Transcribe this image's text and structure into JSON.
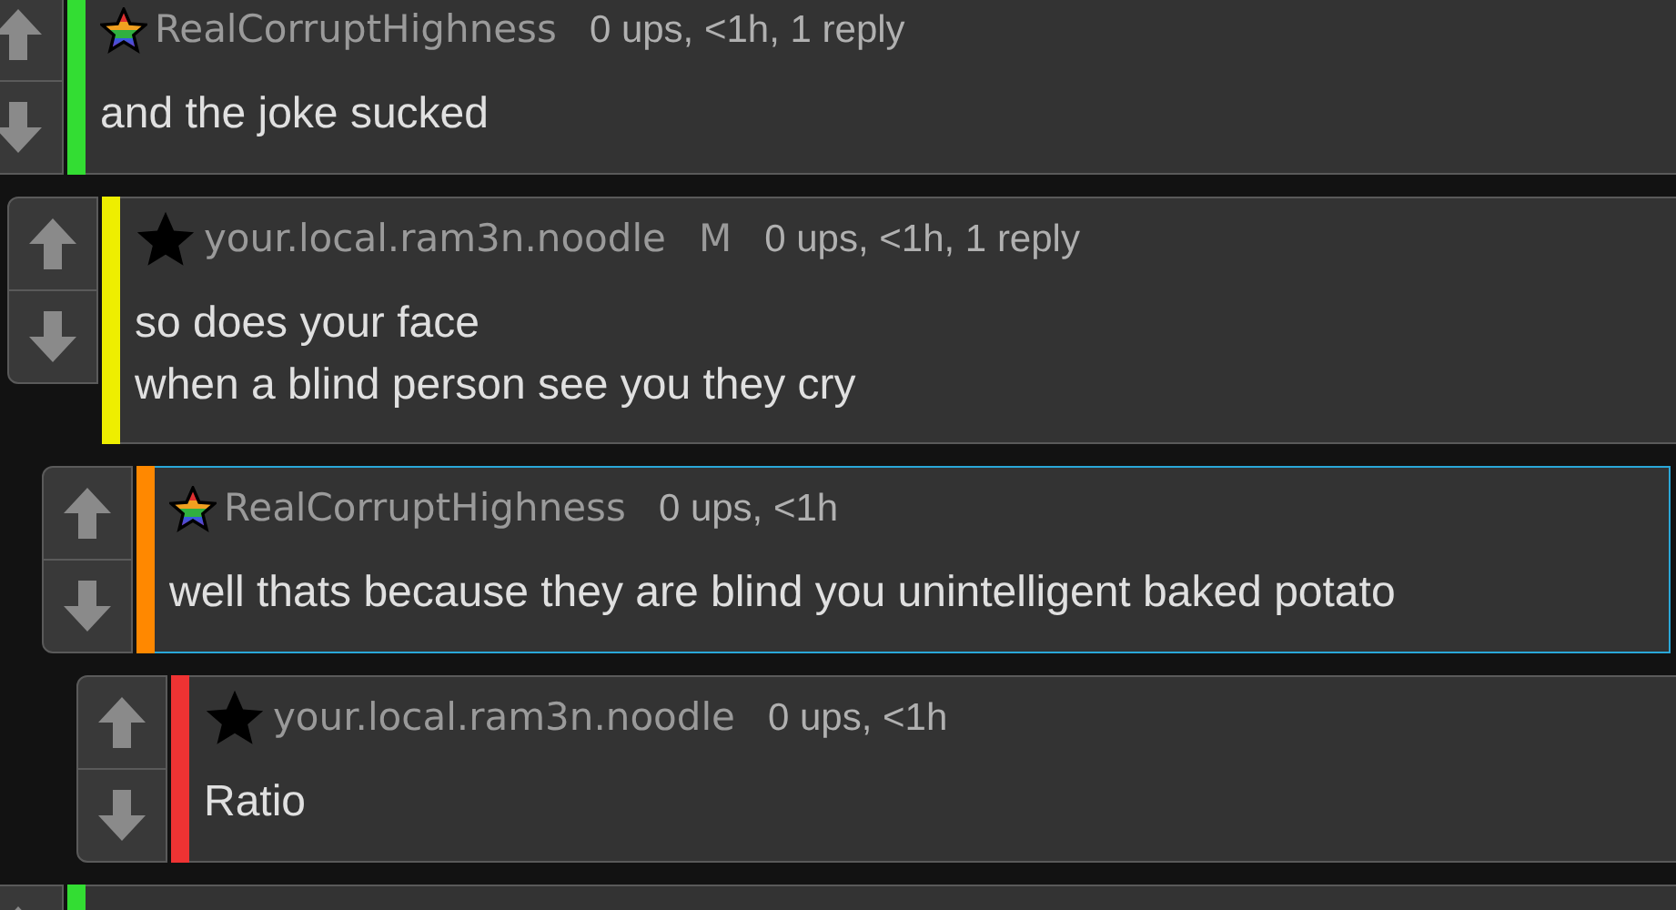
{
  "comments": [
    {
      "author": "RealCorruptHighness",
      "kind": "rainbow",
      "meta": "0 ups, <1h, 1 reply",
      "color": "#33dd33",
      "highlighted": false,
      "lines": [
        "and the joke sucked"
      ],
      "children": [
        {
          "author": "your.local.ram3n.noodle",
          "kind": "plain",
          "badge": "M",
          "meta": "0 ups, <1h, 1 reply",
          "color": "#eeee00",
          "highlighted": false,
          "lines": [
            "so does your face",
            "when a blind person see you they cry"
          ],
          "children": [
            {
              "author": "RealCorruptHighness",
              "kind": "rainbow",
              "meta": "0 ups, <1h",
              "color": "#ff8800",
              "highlighted": true,
              "lines": [
                "well thats because they are blind you unintelligent baked potato"
              ],
              "children": [
                {
                  "author": "your.local.ram3n.noodle",
                  "kind": "plain",
                  "meta": "0 ups, <1h",
                  "color": "#ee3333",
                  "highlighted": false,
                  "lines": [
                    "Ratio"
                  ]
                }
              ]
            }
          ]
        }
      ]
    },
    {
      "color": "#33dd33",
      "highlighted": false
    }
  ]
}
